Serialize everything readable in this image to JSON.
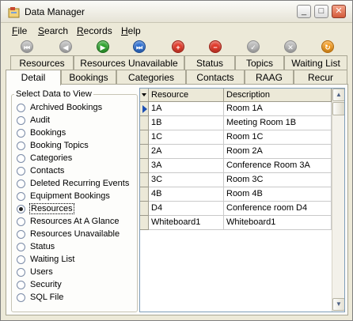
{
  "window": {
    "title": "Data Manager",
    "controls": {
      "minimize": "_",
      "maximize": "□",
      "close": "✕"
    }
  },
  "menu": [
    {
      "ul": "F",
      "rest": "ile"
    },
    {
      "ul": "S",
      "rest": "earch"
    },
    {
      "ul": "R",
      "rest": "ecords"
    },
    {
      "ul": "H",
      "rest": "elp"
    }
  ],
  "toolbar": [
    {
      "icon": "first-record-icon",
      "glyph": "⏮",
      "color": "gray"
    },
    {
      "icon": "previous-record-icon",
      "glyph": "◀",
      "color": "gray"
    },
    {
      "icon": "next-record-icon",
      "glyph": "▶",
      "color": "green"
    },
    {
      "icon": "last-record-icon",
      "glyph": "⏭",
      "color": "blue"
    },
    {
      "icon": "add-record-icon",
      "glyph": "+",
      "color": "red"
    },
    {
      "icon": "delete-record-icon",
      "glyph": "−",
      "color": "red"
    },
    {
      "icon": "save-record-icon",
      "glyph": "✓",
      "color": "gray"
    },
    {
      "icon": "cancel-edit-icon",
      "glyph": "✕",
      "color": "gray"
    },
    {
      "icon": "refresh-icon",
      "glyph": "↻",
      "color": "orange"
    }
  ],
  "tabs_top": [
    "Resources",
    "Resources Unavailable",
    "Status",
    "Topics",
    "Waiting List"
  ],
  "tabs_bottom": [
    "Detail",
    "Bookings",
    "Categories",
    "Contacts",
    "RAAG",
    "Recur"
  ],
  "active_tab": "Detail",
  "select_group": {
    "legend": "Select Data to View",
    "options": [
      "Archived Bookings",
      "Audit",
      "Bookings",
      "Booking Topics",
      "Categories",
      "Contacts",
      "Deleted Recurring Events",
      "Equipment Bookings",
      "Resources",
      "Resources At A Glance",
      "Resources Unavailable",
      "Status",
      "Waiting List",
      "Users",
      "Security",
      "SQL File"
    ],
    "selected": "Resources"
  },
  "grid": {
    "columns": [
      "Resource",
      "Description"
    ],
    "rows": [
      [
        "1A",
        "Room 1A"
      ],
      [
        "1B",
        "Meeting Room 1B"
      ],
      [
        "1C",
        "Room 1C"
      ],
      [
        "2A",
        "Room 2A"
      ],
      [
        "3A",
        "Conference Room 3A"
      ],
      [
        "3C",
        "Room 3C"
      ],
      [
        "4B",
        "Room 4B"
      ],
      [
        "D4",
        "Conference room D4"
      ],
      [
        "Whiteboard1",
        "Whiteboard1"
      ]
    ],
    "current_row": 0
  },
  "colors": {
    "window_bg": "#ece9d8",
    "panel_bg": "#fdfdfb",
    "row_indicator": "#1c4fb3"
  }
}
